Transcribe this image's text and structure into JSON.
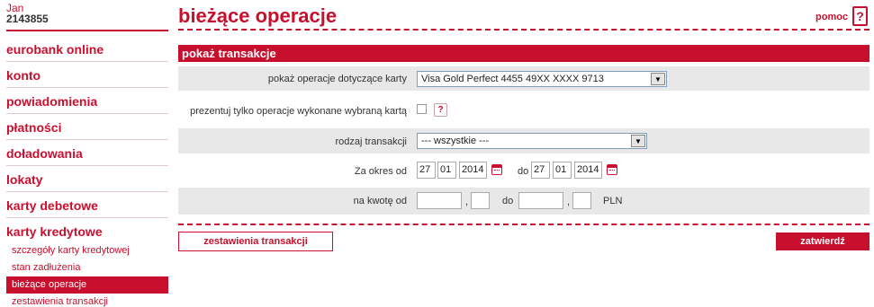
{
  "user": {
    "first_name": "Jan",
    "client_id": "2143855"
  },
  "sidebar": {
    "items": [
      {
        "label": "eurobank online"
      },
      {
        "label": "konto"
      },
      {
        "label": "powiadomienia"
      },
      {
        "label": "płatności"
      },
      {
        "label": "doładowania"
      },
      {
        "label": "lokaty"
      },
      {
        "label": "karty debetowe"
      },
      {
        "label": "karty kredytowe"
      }
    ],
    "sub_items": [
      {
        "label": "szczegóły karty kredytowej"
      },
      {
        "label": "stan zadłużenia"
      },
      {
        "label": "bieżące operacje"
      },
      {
        "label": "zestawienia transakcji"
      }
    ]
  },
  "header": {
    "title": "bieżące operacje",
    "help": "pomoc",
    "help_icon": "?"
  },
  "form": {
    "section_title": "pokaż transakcje",
    "card_label": "pokaż operacje dotyczące karty",
    "card_value": "Visa Gold Perfect 4455 49XX XXXX 9713",
    "only_selected_label": "prezentuj tylko operacje wykonane wybraną kartą",
    "only_selected_checked": false,
    "type_label": "rodzaj transakcji",
    "type_value": "--- wszystkie ---",
    "period_label": "Za okres od",
    "date_from": {
      "day": "27",
      "month": "01",
      "year": "2014"
    },
    "to_label": "do",
    "date_to": {
      "day": "27",
      "month": "01",
      "year": "2014"
    },
    "amount_label": "na kwotę od",
    "amount_from": {
      "whole": "",
      "fraction": ""
    },
    "amount_to_label": "do",
    "amount_to": {
      "whole": "",
      "fraction": ""
    },
    "comma": ",",
    "currency": "PLN"
  },
  "actions": {
    "statements_button": "zestawienia transakcji",
    "confirm_button": "zatwierdź"
  },
  "colors": {
    "brand": "#c8102e",
    "row_shade": "#e8e8e8"
  }
}
